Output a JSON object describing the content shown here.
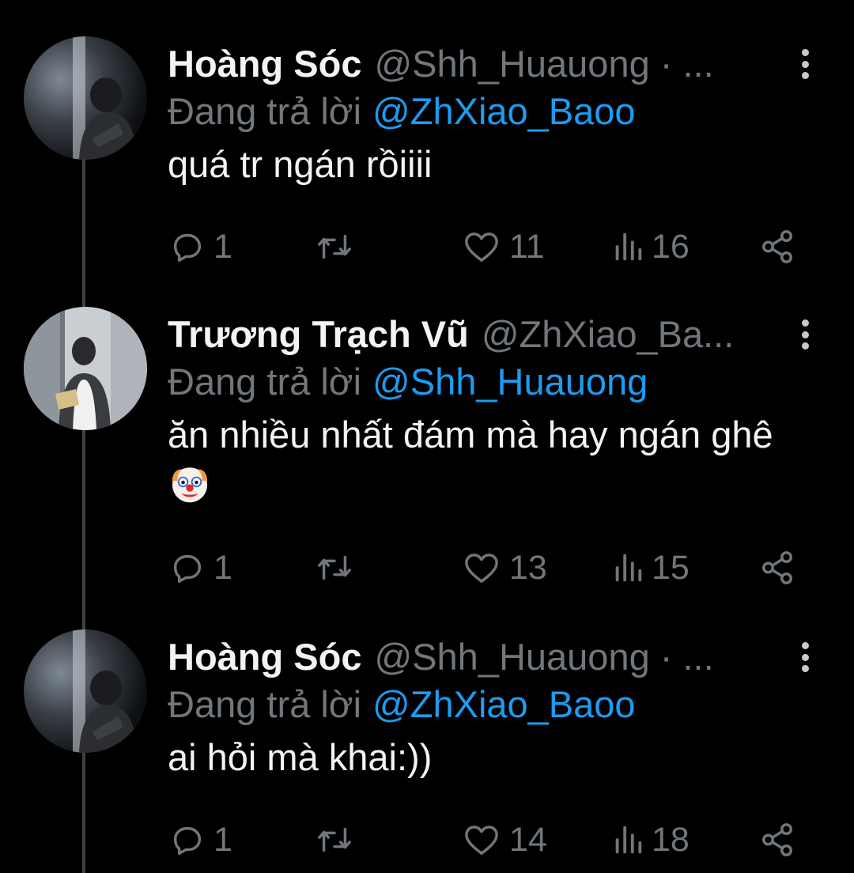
{
  "tweets": [
    {
      "display_name": "Hoàng Sóc",
      "handle": "@Shh_Huauong · ...",
      "reply_prefix": "Đang trả lời",
      "reply_to": "@ZhXiao_Baoo",
      "text": "quá tr ngán rồiiii",
      "emoji": "",
      "replies": "1",
      "retweets": "",
      "likes": "11",
      "views": "16",
      "avatar": "dark-portrait"
    },
    {
      "display_name": "Trương Trạch Vũ",
      "handle": "@ZhXiao_Ba...",
      "reply_prefix": "Đang trả lời",
      "reply_to": "@Shh_Huauong",
      "text": "ăn nhiều nhất đám mà hay ngán ghê",
      "emoji": "clown-face-emoji",
      "replies": "1",
      "retweets": "",
      "likes": "13",
      "views": "15",
      "avatar": "light-portrait"
    },
    {
      "display_name": "Hoàng Sóc",
      "handle": "@Shh_Huauong · ...",
      "reply_prefix": "Đang trả lời",
      "reply_to": "@ZhXiao_Baoo",
      "text": "ai hỏi mà khai:))",
      "emoji": "",
      "replies": "1",
      "retweets": "",
      "likes": "14",
      "views": "18",
      "avatar": "dark-portrait"
    }
  ],
  "colors": {
    "background": "#000000",
    "primary_text": "#f2f3f3",
    "secondary_text": "#71767b",
    "mention": "#1d9bf0",
    "thread_line": "#3e4144"
  },
  "icons": {
    "reply": "reply-icon",
    "retweet": "retweet-icon",
    "like": "like-icon",
    "views": "views-icon",
    "share": "share-icon",
    "more": "more-icon"
  }
}
